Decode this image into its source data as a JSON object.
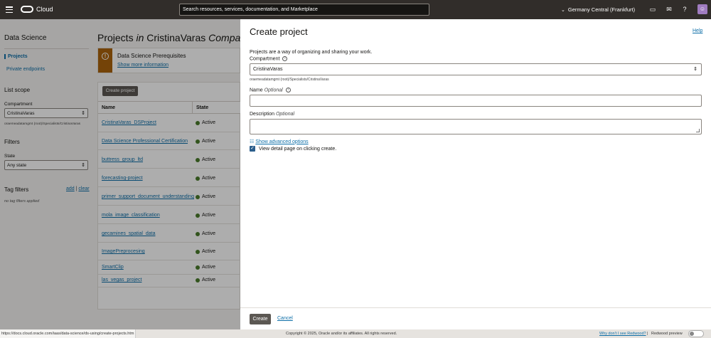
{
  "topbar": {
    "brand": "Cloud",
    "search_placeholder": "Search resources, services, documentation, and Marketplace",
    "region": "Germany Central (Frankfurt)",
    "icons": [
      "hamburger-icon",
      "oracle-logo",
      "chevron-down-icon",
      "cloud-shell-icon",
      "announcements-icon",
      "help-icon",
      "profile-icon"
    ]
  },
  "sidebar": {
    "title": "Data Science",
    "items": [
      {
        "label": "Projects",
        "active": true
      },
      {
        "label": "Private endpoints",
        "active": false
      }
    ],
    "list_scope": {
      "title": "List scope",
      "compartment_label": "Compartment",
      "compartment_value": "CristinaVaras",
      "compartment_path": "oraemeadatamgmt (root)/Specialists/CristinaVaras"
    },
    "filters": {
      "title": "Filters",
      "state_label": "State",
      "state_value": "Any state"
    },
    "tag_filters": {
      "title": "Tag filters",
      "add": "add",
      "separator": "|",
      "clear": "clear",
      "empty": "no tag filters applied"
    }
  },
  "main": {
    "title_prefix": "Projects",
    "title_in": "in",
    "title_compartment": "CristinaVaras",
    "title_suffix": "Compartment",
    "prereq": {
      "title": "Data Science Prerequisites",
      "link": "Show more information",
      "icon": "warning-icon"
    },
    "create_button": "Create project",
    "columns": [
      "Name",
      "State"
    ],
    "rows": [
      {
        "name": "CristinaVaras_DSProject",
        "state": "Active"
      },
      {
        "name": "Data Science Professional Certification",
        "state": "Active"
      },
      {
        "name": "buttress_group_ltd",
        "state": "Active"
      },
      {
        "name": "forecasting-project",
        "state": "Active"
      },
      {
        "name": "primer_support_document_understanding",
        "state": "Active"
      },
      {
        "name": "mola_image_classification",
        "state": "Active"
      },
      {
        "name": "gecamines_spatial_data",
        "state": "Active"
      },
      {
        "name": "ImagePreprocesing",
        "state": "Active"
      },
      {
        "name": "SmartClip",
        "state": "Active"
      },
      {
        "name": "las_vegas_project",
        "state": "Active"
      }
    ]
  },
  "panel": {
    "title": "Create project",
    "help": "Help",
    "description": "Projects are a way of organizing and sharing your work.",
    "compartment_label": "Compartment",
    "compartment_value": "CristinaVaras",
    "compartment_path": "oraemeadatamgmt (root)/Specialists/CristinaVaras",
    "name_label": "Name",
    "name_optional": "Optional",
    "name_value": "",
    "description_label": "Description",
    "description_optional": "Optional",
    "description_value": "",
    "advanced_link": "Show advanced options",
    "view_detail_label": "View detail page on clicking create.",
    "view_detail_checked": true,
    "create_button": "Create",
    "cancel_link": "Cancel"
  },
  "footer": {
    "status_url": "https://docs.cloud.oracle.com/iaas/data-science/ds-using/create-projects.htm",
    "copyright": "Copyright © 2025, Oracle and/or its affiliates. All rights reserved.",
    "redwood_question": "Why don't I see Redwood?",
    "separator": "|",
    "redwood_preview": "Redwood preview"
  },
  "colors": {
    "topbar": "#312d2a",
    "link": "#0e6fa8",
    "warning": "#ac630c",
    "active_state": "#4a7c2b",
    "button": "#5c5853"
  }
}
